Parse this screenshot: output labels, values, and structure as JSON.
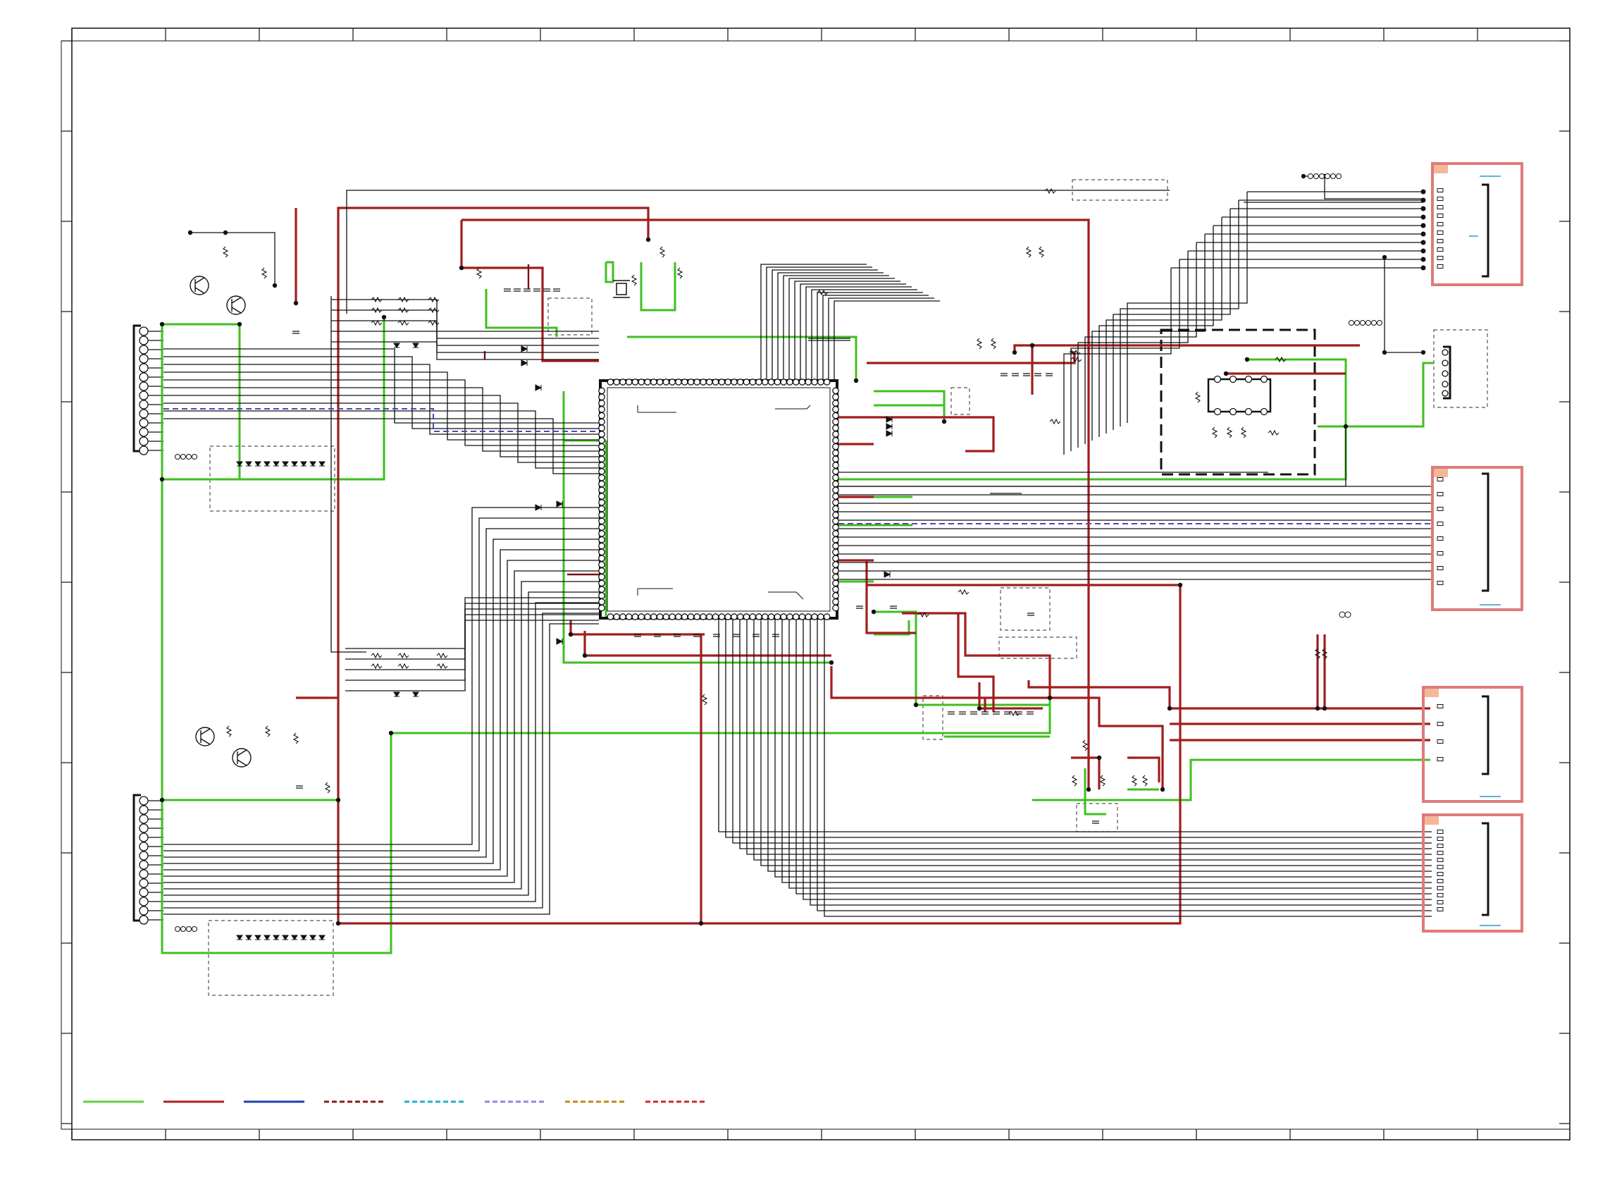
{
  "drawing": {
    "text": [],
    "colors": {
      "border": "#111111",
      "ground_net": "#3fbf1f",
      "power_net": "#a11d1d",
      "connector_outline": "#e07a7a",
      "connector_tab": "#f3b89a"
    }
  },
  "legend": {
    "items": [
      {
        "style": "solid",
        "color": "#5fd33a"
      },
      {
        "style": "solid",
        "color": "#b01e1e"
      },
      {
        "style": "solid",
        "color": "#1e3fb0"
      },
      {
        "style": "dashed",
        "color": "#8b1a1a"
      },
      {
        "style": "dashed",
        "color": "#1fb0d0"
      },
      {
        "style": "dashed",
        "color": "#8f85e8"
      },
      {
        "style": "dashed",
        "color": "#c08a1e"
      },
      {
        "style": "dashed",
        "color": "#d02828"
      }
    ]
  },
  "components": {
    "main_ic_pins_per_side": 36,
    "connectors": 5,
    "transistors": 4
  }
}
